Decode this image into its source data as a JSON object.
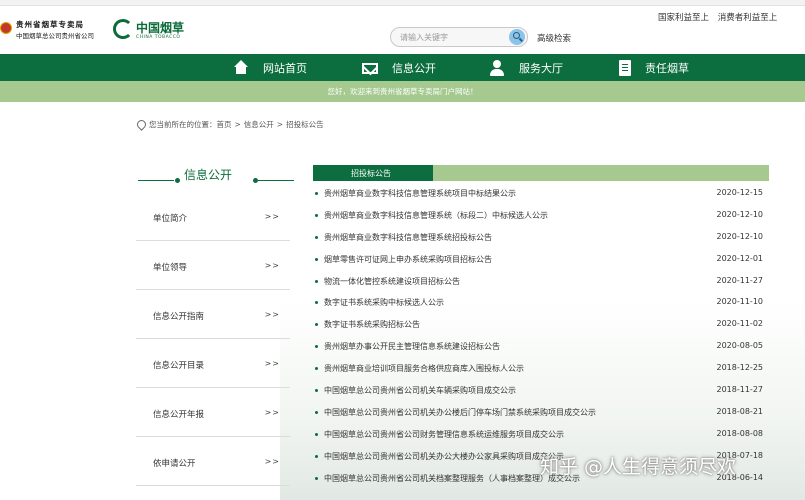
{
  "header": {
    "logo_line1": "贵州省烟草专卖局",
    "logo_line2": "中国烟草总公司贵州省公司",
    "brand_name": "中国烟草",
    "brand_sub": "CHINA TOBACCO",
    "search_placeholder": "请输入关键字",
    "advanced_search": "高级检索",
    "top_link1": "国家利益至上",
    "top_link2": "消费者利益至上"
  },
  "nav": {
    "items": [
      {
        "label": "网站首页",
        "icon": "home-icon"
      },
      {
        "label": "信息公开",
        "icon": "mail-icon"
      },
      {
        "label": "服务大厅",
        "icon": "user-icon"
      },
      {
        "label": "责任烟草",
        "icon": "document-icon"
      }
    ]
  },
  "welcome_text": "您好，欢迎来到贵州省烟草专卖局门户网站！",
  "breadcrumb": {
    "prefix": "您当前所在的位置：",
    "items": [
      "首页",
      "信息公开",
      "招投标公告"
    ],
    "separator": ">"
  },
  "sidebar": {
    "title": "信息公开",
    "arrow": ">>",
    "items": [
      {
        "label": "单位简介"
      },
      {
        "label": "单位领导"
      },
      {
        "label": "信息公开指南"
      },
      {
        "label": "信息公开目录"
      },
      {
        "label": "信息公开年报"
      },
      {
        "label": "依申请公开"
      }
    ]
  },
  "content": {
    "tab_label": "招投标公告",
    "rows": [
      {
        "title": "贵州烟草商业数字科技信息管理系统项目中标结果公示",
        "date": "2020-12-15"
      },
      {
        "title": "贵州烟草商业数字科技信息管理系统（标段二）中标候选人公示",
        "date": "2020-12-10"
      },
      {
        "title": "贵州烟草商业数字科技信息管理系统招投标公告",
        "date": "2020-12-10"
      },
      {
        "title": "烟草零售许可证网上申办系统采购项目招标公告",
        "date": "2020-12-01"
      },
      {
        "title": "物流一体化管控系统建设项目招标公告",
        "date": "2020-11-27"
      },
      {
        "title": "数字证书系统采购中标候选人公示",
        "date": "2020-11-10"
      },
      {
        "title": "数字证书系统采购招标公告",
        "date": "2020-11-02"
      },
      {
        "title": "贵州烟草办事公开民主管理信息系统建设招标公告",
        "date": "2020-08-05"
      },
      {
        "title": "贵州烟草商业培训项目服务合格供应商库入围投标人公示",
        "date": "2018-12-25"
      },
      {
        "title": "中国烟草总公司贵州省公司机关车辆采购项目成交公示",
        "date": "2018-11-27"
      },
      {
        "title": "中国烟草总公司贵州省公司机关办公楼后门停车场门禁系统采购项目成交公示",
        "date": "2018-08-21"
      },
      {
        "title": "中国烟草总公司贵州省公司财务管理信息系统运维服务项目成交公示",
        "date": "2018-08-08"
      },
      {
        "title": "中国烟草总公司贵州省公司机关办公大楼办公家具采购项目成交公示",
        "date": "2018-07-18"
      },
      {
        "title": "中国烟草总公司贵州省公司机关档案整理服务（人事档案整理）成交公示",
        "date": "2018-06-14"
      }
    ]
  },
  "watermark": "知乎 @人生得意须尽欢",
  "colors": {
    "primary_green": "#0c6e3f",
    "light_green": "#a5c98f"
  }
}
